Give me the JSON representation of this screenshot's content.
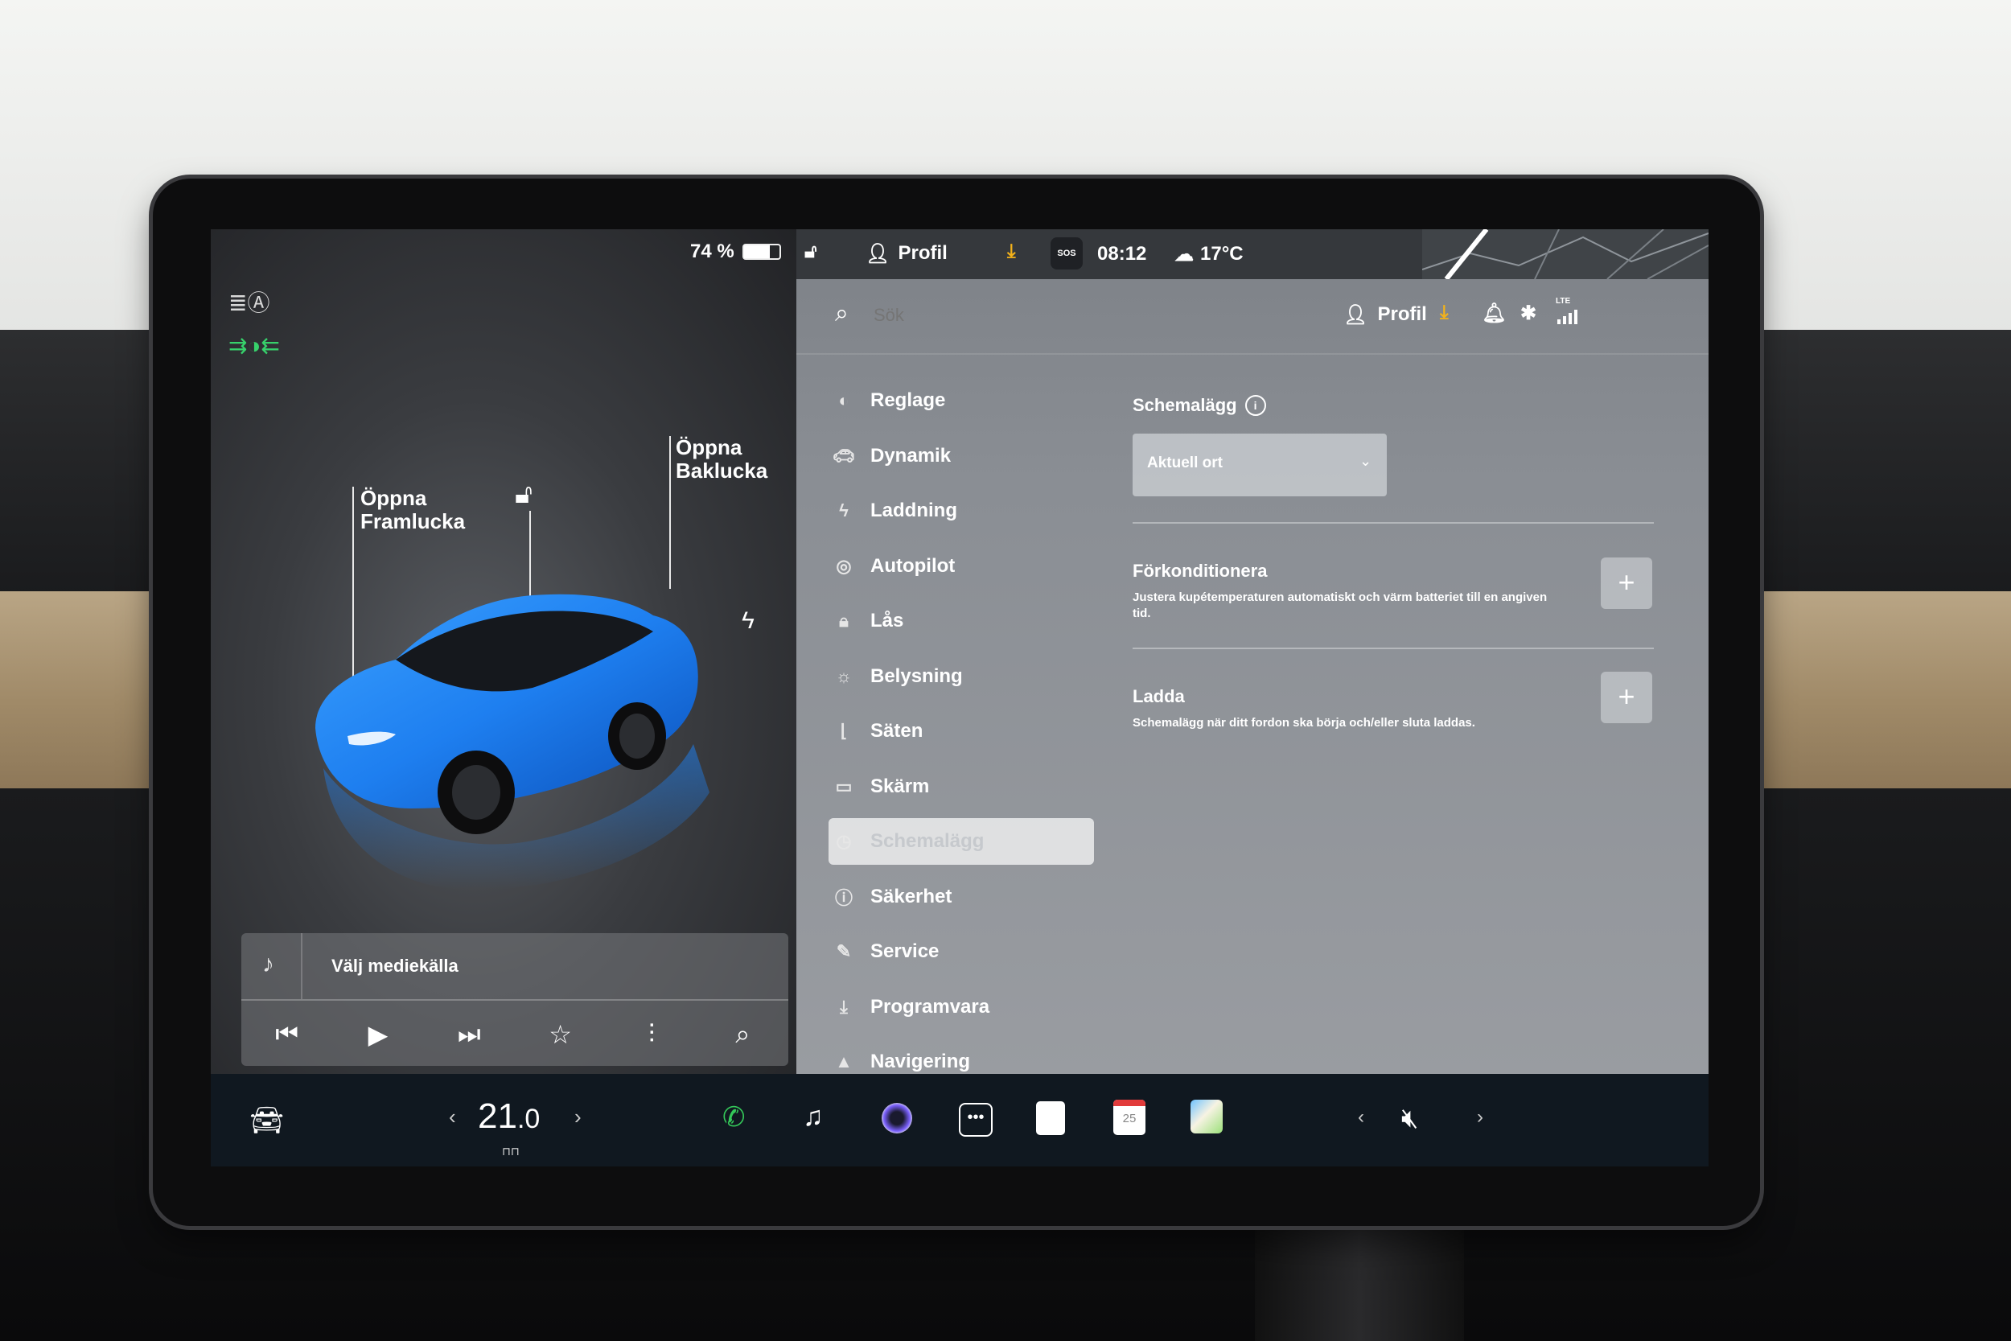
{
  "environment": {
    "note_visible": ""
  },
  "left_pane": {
    "battery_percent": "74 %",
    "battery_level": 0.74,
    "callouts": {
      "frunk": {
        "line1": "Öppna",
        "line2": "Framlucka"
      },
      "trunk": {
        "line1": "Öppna",
        "line2": "Baklucka"
      }
    },
    "icons": [
      "headlight-auto-icon",
      "parking-lights-icon",
      "unlock-icon",
      "charge-port-icon"
    ],
    "media": {
      "source_label": "Välj mediekälla",
      "controls": [
        "previous-icon",
        "play-icon",
        "next-icon",
        "favorite-icon",
        "equalizer-icon",
        "search-icon"
      ]
    }
  },
  "status_bar": {
    "profile_label": "Profil",
    "sos_label": "SOS",
    "time": "08:12",
    "temperature": "17°C"
  },
  "search_row": {
    "placeholder": "Sök",
    "profile_label": "Profil",
    "lte_label": "LTE"
  },
  "menu": [
    {
      "label": "Reglage",
      "icon": "toggle-icon"
    },
    {
      "label": "Dynamik",
      "icon": "car-icon"
    },
    {
      "label": "Laddning",
      "icon": "bolt-icon"
    },
    {
      "label": "Autopilot",
      "icon": "steering-wheel-icon"
    },
    {
      "label": "Lås",
      "icon": "lock-icon"
    },
    {
      "label": "Belysning",
      "icon": "sun-icon"
    },
    {
      "label": "Säten",
      "icon": "seat-icon"
    },
    {
      "label": "Skärm",
      "icon": "display-icon"
    },
    {
      "label": "Schemalägg",
      "icon": "clock-icon",
      "active": true
    },
    {
      "label": "Säkerhet",
      "icon": "info-circle-icon"
    },
    {
      "label": "Service",
      "icon": "wrench-icon"
    },
    {
      "label": "Programvara",
      "icon": "download-icon"
    },
    {
      "label": "Navigering",
      "icon": "navigation-icon"
    }
  ],
  "schedule": {
    "title": "Schemalägg",
    "location_dropdown": "Aktuell ort",
    "precondition": {
      "title": "Förkonditionera",
      "description": "Justera kupétemperaturen automatiskt och värm batteriet till en angiven tid."
    },
    "charge": {
      "title": "Ladda",
      "description": "Schemalägg när ditt fordon ska börja och/eller sluta laddas."
    },
    "add_symbol": "+"
  },
  "bottom_bar": {
    "temperature_integer": "21",
    "temperature_decimal": ".0",
    "calendar_day": "25",
    "left_arrow": "‹",
    "right_arrow": "›",
    "volume_icon": "mute-icon",
    "colors": {
      "phone": "#34c759",
      "calendar_accent": "#e23b3b",
      "bar_bg": "#101820"
    }
  },
  "colors": {
    "car_body": "#1e7ff0",
    "download_accent": "#f3b21a",
    "parking_lights": "#37d16b"
  }
}
